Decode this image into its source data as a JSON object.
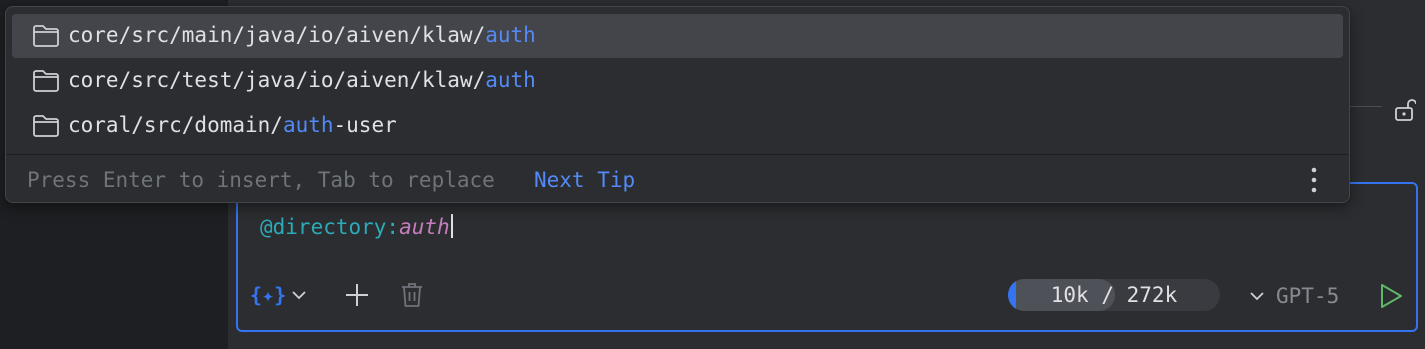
{
  "popup": {
    "items": [
      {
        "prefix": "core/src/main/java/io/aiven/klaw/",
        "match": "auth",
        "suffix": "",
        "selected": true
      },
      {
        "prefix": "core/src/test/java/io/aiven/klaw/",
        "match": "auth",
        "suffix": "",
        "selected": false
      },
      {
        "prefix": "coral/src/domain/",
        "match": "auth",
        "suffix": "-user",
        "selected": false
      }
    ],
    "hint": "Press Enter to insert, Tab to replace",
    "next_tip": "Next Tip"
  },
  "input": {
    "mention": "@directory:",
    "argument": "auth"
  },
  "toolbar": {
    "context_label": "{✦}",
    "tokens_used": "10k",
    "tokens_sep": " / ",
    "tokens_total": "272k",
    "token_usage_fraction": 0.037,
    "model": "GPT-5"
  },
  "colors": {
    "accent": "#3574f0",
    "match": "#548af7",
    "send": "#5fb865"
  }
}
